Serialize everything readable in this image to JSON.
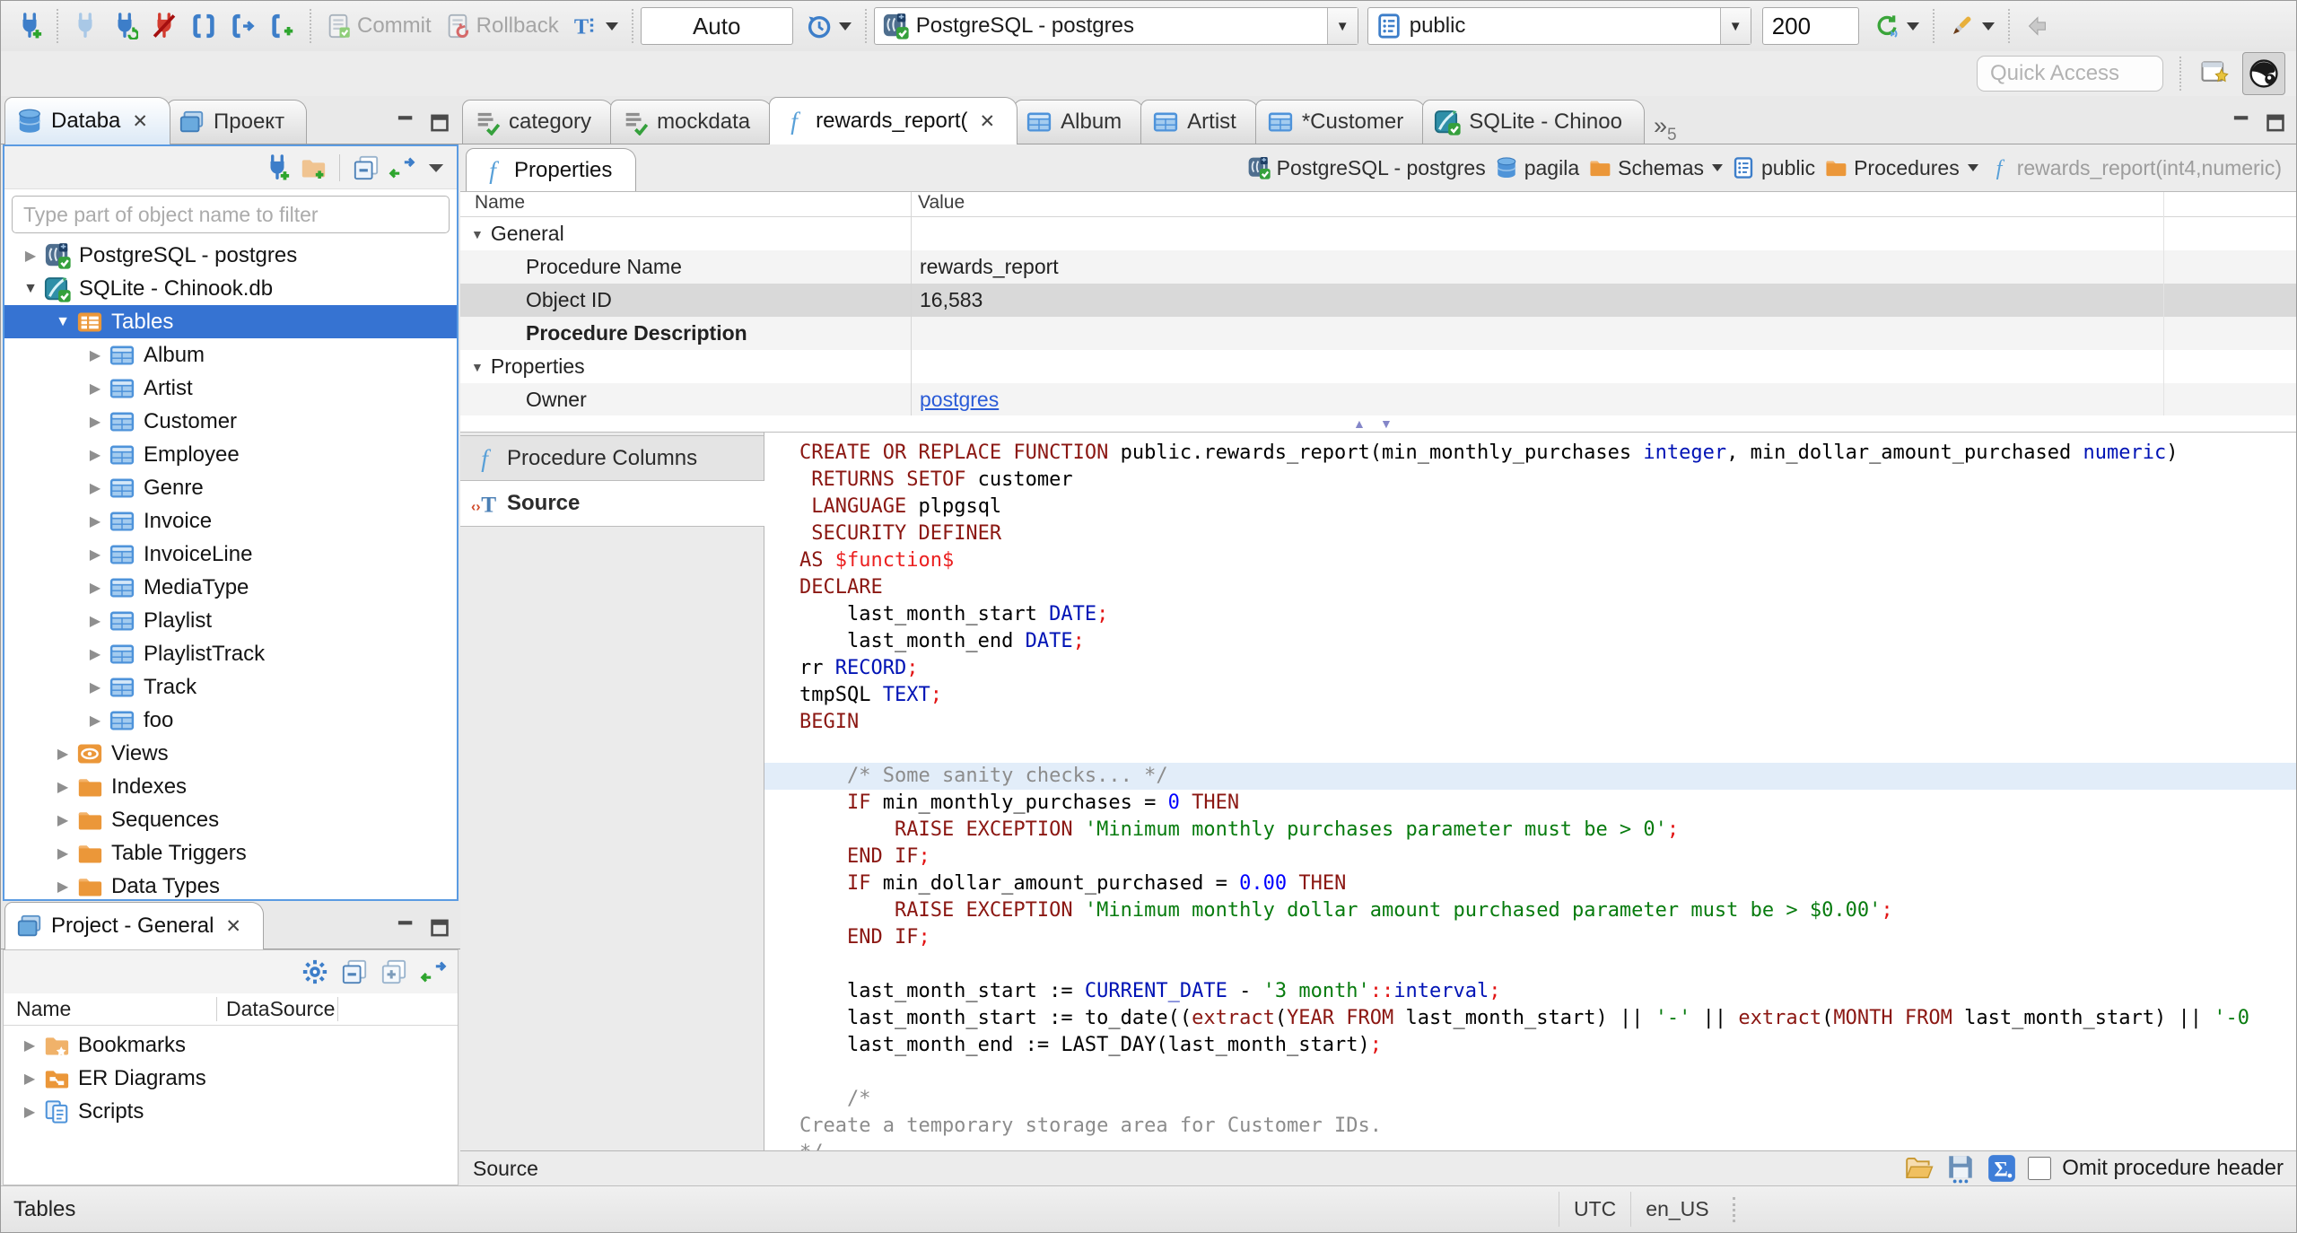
{
  "toolbar": {
    "commit_label": "Commit",
    "rollback_label": "Rollback",
    "txn_mode": "Auto",
    "connection": "PostgreSQL - postgres",
    "schema": "public",
    "fetch_size": "200",
    "quick_access_placeholder": "Quick Access"
  },
  "editor_tabs": {
    "tabs": [
      {
        "label": "category",
        "icon": "script-check"
      },
      {
        "label": "mockdata",
        "icon": "script-check"
      },
      {
        "label": "rewards_report(",
        "icon": "function",
        "active": true,
        "closable": true
      },
      {
        "label": "Album",
        "icon": "table"
      },
      {
        "label": "Artist",
        "icon": "table"
      },
      {
        "label": "*Customer",
        "icon": "table"
      },
      {
        "label": "SQLite - Chinoo",
        "icon": "sqlite-db"
      }
    ],
    "overflow_count": "5"
  },
  "sidebar": {
    "tabs": [
      {
        "label": "Databa",
        "icon": "database",
        "active": true,
        "closable": true
      },
      {
        "label": "Проект",
        "icon": "projects"
      }
    ],
    "filter_placeholder": "Type part of object name to filter",
    "tree": [
      {
        "label": "PostgreSQL - postgres",
        "icon": "postgres-db",
        "depth": 0,
        "state": "collapsed"
      },
      {
        "label": "SQLite - Chinook.db",
        "icon": "sqlite-db",
        "depth": 0,
        "state": "expanded"
      },
      {
        "label": "Tables",
        "icon": "tables",
        "depth": 1,
        "state": "expanded",
        "selected": true
      },
      {
        "label": "Album",
        "icon": "table",
        "depth": 2,
        "state": "collapsed"
      },
      {
        "label": "Artist",
        "icon": "table",
        "depth": 2,
        "state": "collapsed"
      },
      {
        "label": "Customer",
        "icon": "table",
        "depth": 2,
        "state": "collapsed"
      },
      {
        "label": "Employee",
        "icon": "table",
        "depth": 2,
        "state": "collapsed"
      },
      {
        "label": "Genre",
        "icon": "table",
        "depth": 2,
        "state": "collapsed"
      },
      {
        "label": "Invoice",
        "icon": "table",
        "depth": 2,
        "state": "collapsed"
      },
      {
        "label": "InvoiceLine",
        "icon": "table",
        "depth": 2,
        "state": "collapsed"
      },
      {
        "label": "MediaType",
        "icon": "table",
        "depth": 2,
        "state": "collapsed"
      },
      {
        "label": "Playlist",
        "icon": "table",
        "depth": 2,
        "state": "collapsed"
      },
      {
        "label": "PlaylistTrack",
        "icon": "table",
        "depth": 2,
        "state": "collapsed"
      },
      {
        "label": "Track",
        "icon": "table",
        "depth": 2,
        "state": "collapsed"
      },
      {
        "label": "foo",
        "icon": "table",
        "depth": 2,
        "state": "collapsed"
      },
      {
        "label": "Views",
        "icon": "views",
        "depth": 1,
        "state": "collapsed"
      },
      {
        "label": "Indexes",
        "icon": "folder",
        "depth": 1,
        "state": "collapsed"
      },
      {
        "label": "Sequences",
        "icon": "folder",
        "depth": 1,
        "state": "collapsed"
      },
      {
        "label": "Table Triggers",
        "icon": "folder",
        "depth": 1,
        "state": "collapsed"
      },
      {
        "label": "Data Types",
        "icon": "folder",
        "depth": 1,
        "state": "collapsed"
      }
    ]
  },
  "project_panel": {
    "title": "Project - General",
    "columns": [
      "Name",
      "DataSource"
    ],
    "items": [
      {
        "label": "Bookmarks",
        "icon": "bookmarks"
      },
      {
        "label": "ER Diagrams",
        "icon": "er-diagrams"
      },
      {
        "label": "Scripts",
        "icon": "scripts"
      }
    ]
  },
  "properties_view": {
    "tab_label": "Properties",
    "breadcrumb": [
      {
        "label": "PostgreSQL - postgres",
        "icon": "postgres-db"
      },
      {
        "label": "pagila",
        "icon": "database"
      },
      {
        "label": "Schemas",
        "icon": "folder",
        "dropdown": true
      },
      {
        "label": "public",
        "icon": "schema"
      },
      {
        "label": "Procedures",
        "icon": "folder",
        "dropdown": true
      },
      {
        "label": "rewards_report(int4,numeric)",
        "icon": "function",
        "muted": true
      }
    ],
    "grid_columns": [
      "Name",
      "Value"
    ],
    "grid_rows": [
      {
        "name": "General",
        "type": "group"
      },
      {
        "name": "Procedure Name",
        "value": "rewards_report"
      },
      {
        "name": "Object ID",
        "value": "16,583",
        "selected": true
      },
      {
        "name": "Procedure Description",
        "bold": true,
        "value": ""
      },
      {
        "name": "Properties",
        "type": "group"
      },
      {
        "name": "Owner",
        "value": "postgres",
        "link": true
      }
    ],
    "subtabs": [
      {
        "label": "Procedure Columns",
        "icon": "function"
      },
      {
        "label": "Source",
        "icon": "source",
        "active": true
      }
    ],
    "footer_label": "Source",
    "omit_header_label": "Omit procedure header"
  },
  "code": {
    "highlight_line": 13,
    "lines": [
      [
        [
          "k",
          "CREATE OR REPLACE FUNCTION"
        ],
        [
          "i",
          " public.rewards_report(min_monthly_purchases "
        ],
        [
          "t",
          "integer"
        ],
        [
          "i",
          ", min_dollar_amount_purchased "
        ],
        [
          "t",
          "numeric"
        ],
        [
          "i",
          ")"
        ]
      ],
      [
        [
          "i",
          " "
        ],
        [
          "k",
          "RETURNS SETOF"
        ],
        [
          "i",
          " customer"
        ]
      ],
      [
        [
          "i",
          " "
        ],
        [
          "k",
          "LANGUAGE"
        ],
        [
          "i",
          " plpgsql"
        ]
      ],
      [
        [
          "i",
          " "
        ],
        [
          "k",
          "SECURITY DEFINER"
        ]
      ],
      [
        [
          "k",
          "AS"
        ],
        [
          "i",
          " "
        ],
        [
          "d",
          "$function$"
        ]
      ],
      [
        [
          "k",
          "DECLARE"
        ]
      ],
      [
        [
          "i",
          "    last_month_start "
        ],
        [
          "t",
          "DATE"
        ],
        [
          "p",
          ";"
        ]
      ],
      [
        [
          "i",
          "    last_month_end "
        ],
        [
          "t",
          "DATE"
        ],
        [
          "p",
          ";"
        ]
      ],
      [
        [
          "i",
          "rr "
        ],
        [
          "t",
          "RECORD"
        ],
        [
          "p",
          ";"
        ]
      ],
      [
        [
          "i",
          "tmpSQL "
        ],
        [
          "t",
          "TEXT"
        ],
        [
          "p",
          ";"
        ]
      ],
      [
        [
          "k",
          "BEGIN"
        ]
      ],
      [],
      [
        [
          "c",
          "    /* Some sanity checks... */"
        ]
      ],
      [
        [
          "i",
          "    "
        ],
        [
          "k",
          "IF"
        ],
        [
          "i",
          " min_monthly_purchases = "
        ],
        [
          "n",
          "0"
        ],
        [
          "i",
          " "
        ],
        [
          "k",
          "THEN"
        ]
      ],
      [
        [
          "i",
          "        "
        ],
        [
          "k",
          "RAISE EXCEPTION"
        ],
        [
          "i",
          " "
        ],
        [
          "s",
          "'Minimum monthly purchases parameter must be > 0'"
        ],
        [
          "p",
          ";"
        ]
      ],
      [
        [
          "i",
          "    "
        ],
        [
          "k",
          "END IF"
        ],
        [
          "p",
          ";"
        ]
      ],
      [
        [
          "i",
          "    "
        ],
        [
          "k",
          "IF"
        ],
        [
          "i",
          " min_dollar_amount_purchased = "
        ],
        [
          "n",
          "0.00"
        ],
        [
          "i",
          " "
        ],
        [
          "k",
          "THEN"
        ]
      ],
      [
        [
          "i",
          "        "
        ],
        [
          "k",
          "RAISE EXCEPTION"
        ],
        [
          "i",
          " "
        ],
        [
          "s",
          "'Minimum monthly dollar amount purchased parameter must be > $0.00'"
        ],
        [
          "p",
          ";"
        ]
      ],
      [
        [
          "i",
          "    "
        ],
        [
          "k",
          "END IF"
        ],
        [
          "p",
          ";"
        ]
      ],
      [],
      [
        [
          "i",
          "    last_month_start := "
        ],
        [
          "t",
          "CURRENT_DATE"
        ],
        [
          "i",
          " - "
        ],
        [
          "s",
          "'3 month'"
        ],
        [
          "p",
          "::"
        ],
        [
          "t",
          "interval"
        ],
        [
          "p",
          ";"
        ]
      ],
      [
        [
          "i",
          "    last_month_start := to_date(("
        ],
        [
          "k",
          "extract"
        ],
        [
          "i",
          "("
        ],
        [
          "k",
          "YEAR FROM"
        ],
        [
          "i",
          " last_month_start) || "
        ],
        [
          "s",
          "'-'"
        ],
        [
          "i",
          " || "
        ],
        [
          "k",
          "extract"
        ],
        [
          "i",
          "("
        ],
        [
          "k",
          "MONTH FROM"
        ],
        [
          "i",
          " last_month_start) || "
        ],
        [
          "s",
          "'-0"
        ]
      ],
      [
        [
          "i",
          "    last_month_end := LAST_DAY(last_month_start)"
        ],
        [
          "p",
          ";"
        ]
      ],
      [],
      [
        [
          "c",
          "    /*"
        ]
      ],
      [
        [
          "c",
          "Create a temporary storage area for Customer IDs."
        ]
      ],
      [
        [
          "c",
          "*/"
        ]
      ]
    ]
  },
  "status_bar": {
    "left": "Tables",
    "timezone": "UTC",
    "locale": "en_US"
  }
}
